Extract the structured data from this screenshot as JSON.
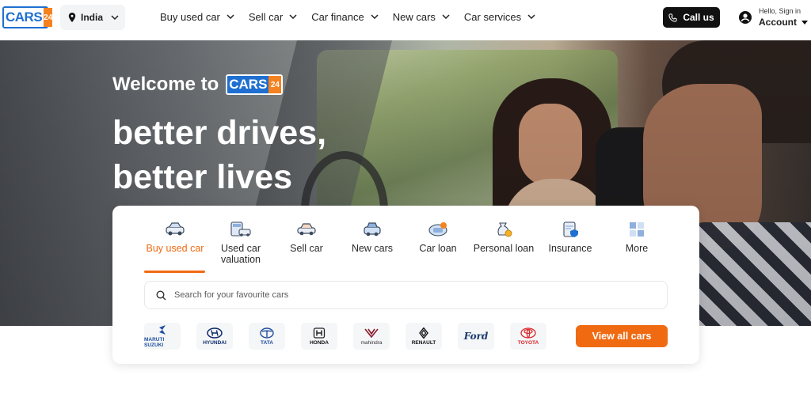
{
  "header": {
    "logo": {
      "text": "CARS",
      "number": "24"
    },
    "location": "India",
    "nav": [
      {
        "label": "Buy used car"
      },
      {
        "label": "Sell car"
      },
      {
        "label": "Car finance"
      },
      {
        "label": "New cars"
      },
      {
        "label": "Car services"
      }
    ],
    "call_button": "Call us",
    "account": {
      "greeting": "Hello, Sign in",
      "label": "Account"
    }
  },
  "hero": {
    "welcome": "Welcome to",
    "welcome_logo": {
      "text": "CARS",
      "number": "24"
    },
    "tagline_line1": "better drives,",
    "tagline_line2": "better lives"
  },
  "card": {
    "categories": [
      {
        "label": "Buy used car",
        "icon": "car-icon",
        "active": true
      },
      {
        "label": "Used car valuation",
        "icon": "calculator-car-icon"
      },
      {
        "label": "Sell car",
        "icon": "sell-car-icon"
      },
      {
        "label": "New cars",
        "icon": "new-car-icon"
      },
      {
        "label": "Car loan",
        "icon": "car-loan-icon"
      },
      {
        "label": "Personal loan",
        "icon": "money-bag-icon"
      },
      {
        "label": "Insurance",
        "icon": "insurance-shield-icon"
      },
      {
        "label": "More",
        "icon": "grid-more-icon"
      }
    ],
    "search_placeholder": "Search for your favourite cars",
    "brands": [
      {
        "name": "MARUTI SUZUKI"
      },
      {
        "name": "HYUNDAI"
      },
      {
        "name": "TATA"
      },
      {
        "name": "HONDA"
      },
      {
        "name": "mahindra"
      },
      {
        "name": "RENAULT"
      },
      {
        "name": "Ford"
      },
      {
        "name": "TOYOTA"
      }
    ],
    "view_all": "View all cars"
  },
  "colors": {
    "accent": "#f06a12",
    "brand_blue": "#1f6fd1",
    "dark": "#111111"
  }
}
